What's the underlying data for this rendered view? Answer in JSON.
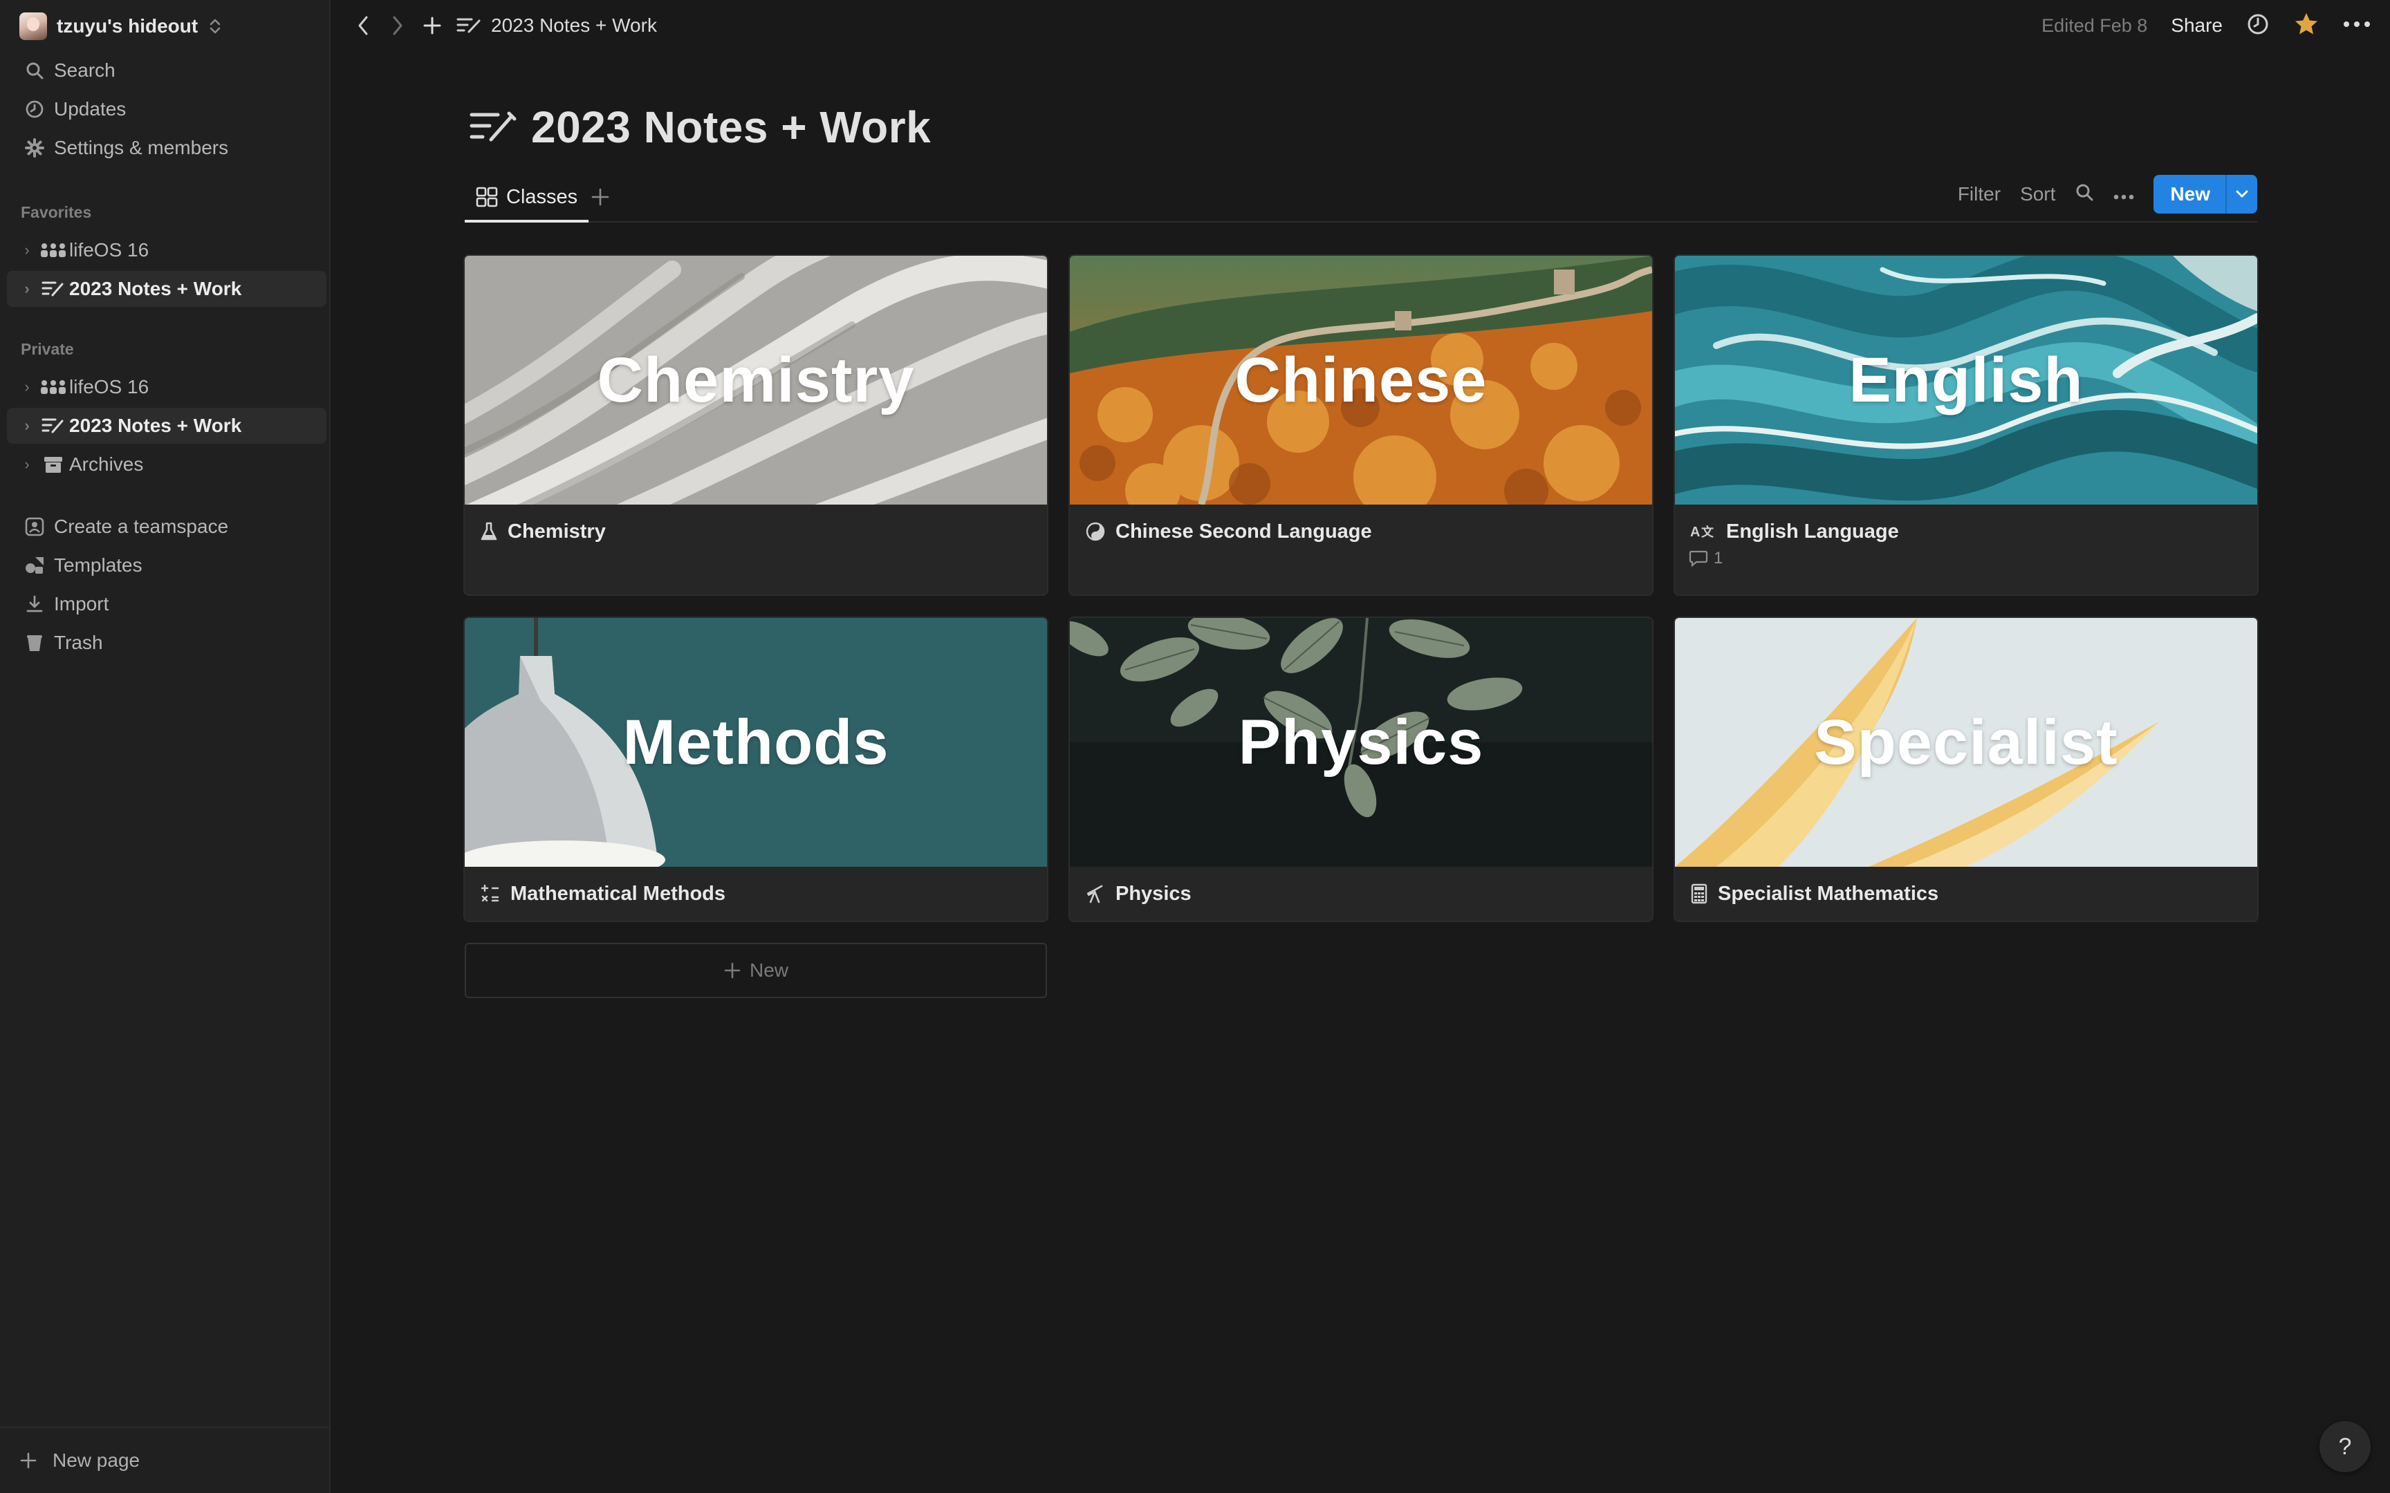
{
  "sidebar": {
    "workspace_name": "tzuyu's hideout",
    "workspace_chevron": "⌃",
    "top_items": [
      {
        "label": "Search",
        "icon": "search-icon"
      },
      {
        "label": "Updates",
        "icon": "clock-icon"
      },
      {
        "label": "Settings & members",
        "icon": "gear-icon"
      }
    ],
    "favorites_header": "Favorites",
    "favorites": [
      {
        "label": "lifeOS 16",
        "icon": "people-icon",
        "active": false
      },
      {
        "label": "2023 Notes + Work",
        "icon": "notes-icon",
        "active": true
      }
    ],
    "private_header": "Private",
    "private": [
      {
        "label": "lifeOS 16",
        "icon": "people-icon",
        "active": false
      },
      {
        "label": "2023 Notes + Work",
        "icon": "notes-icon",
        "active": true
      },
      {
        "label": "Archives",
        "icon": "archive-icon",
        "active": false
      }
    ],
    "bottom_items": [
      {
        "label": "Create a teamspace",
        "icon": "teamspace-icon"
      },
      {
        "label": "Templates",
        "icon": "templates-icon"
      },
      {
        "label": "Import",
        "icon": "import-icon"
      },
      {
        "label": "Trash",
        "icon": "trash-icon"
      }
    ],
    "new_page_label": "New page"
  },
  "topbar": {
    "breadcrumb": "2023 Notes + Work",
    "edited": "Edited Feb 8",
    "share_label": "Share",
    "favorite_color": "#e0a643"
  },
  "page": {
    "title": "2023 Notes + Work",
    "view_tab": "Classes",
    "filter_label": "Filter",
    "sort_label": "Sort",
    "new_label": "New",
    "new_card_label": "New",
    "accent": "#2383e2"
  },
  "cards": [
    {
      "cover_text": "Chemistry",
      "title": "Chemistry",
      "icon": "flask-icon",
      "comments": ""
    },
    {
      "cover_text": "Chinese",
      "title": "Chinese Second Language",
      "icon": "yin-yang-icon",
      "comments": ""
    },
    {
      "cover_text": "English",
      "title": "English Language",
      "icon": "translate-icon",
      "comments": "1"
    },
    {
      "cover_text": "Methods",
      "title": "Mathematical Methods",
      "icon": "math-operators-icon",
      "comments": ""
    },
    {
      "cover_text": "Physics",
      "title": "Physics",
      "icon": "telescope-icon",
      "comments": ""
    },
    {
      "cover_text": "Specialist",
      "title": "Specialist Mathematics",
      "icon": "calculator-icon",
      "comments": ""
    }
  ]
}
